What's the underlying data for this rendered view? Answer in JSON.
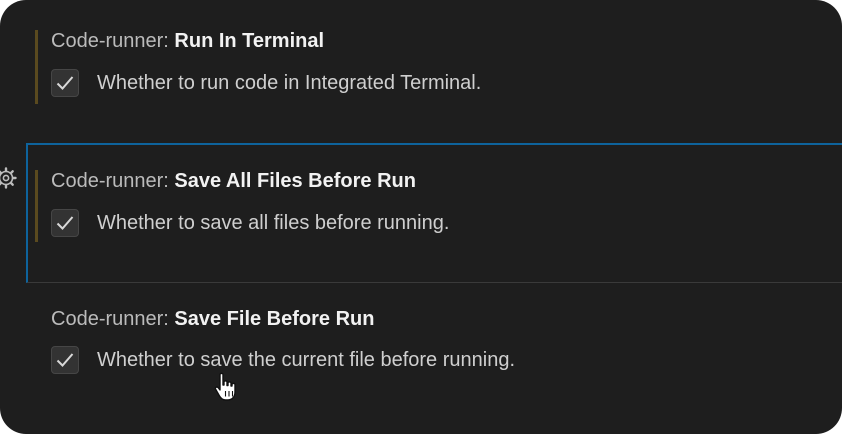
{
  "settings": [
    {
      "category": "Code-runner:",
      "name": "Run In Terminal",
      "description": "Whether to run code in Integrated Terminal.",
      "checked": true,
      "modified": true
    },
    {
      "category": "Code-runner:",
      "name": "Save All Files Before Run",
      "description": "Whether to save all files before running.",
      "checked": true,
      "modified": true,
      "focused": true
    },
    {
      "category": "Code-runner:",
      "name": "Save File Before Run",
      "description": "Whether to save the current file before running.",
      "checked": true,
      "modified": false
    }
  ],
  "icons": {
    "gear": "gear-icon",
    "check": "check-icon",
    "cursor": "hand-pointer-cursor-icon"
  },
  "colors": {
    "background": "#1e1e1e",
    "focus_border": "#0e639c",
    "modified_indicator": "#5a4a1f",
    "checkbox_bg": "#333333"
  }
}
